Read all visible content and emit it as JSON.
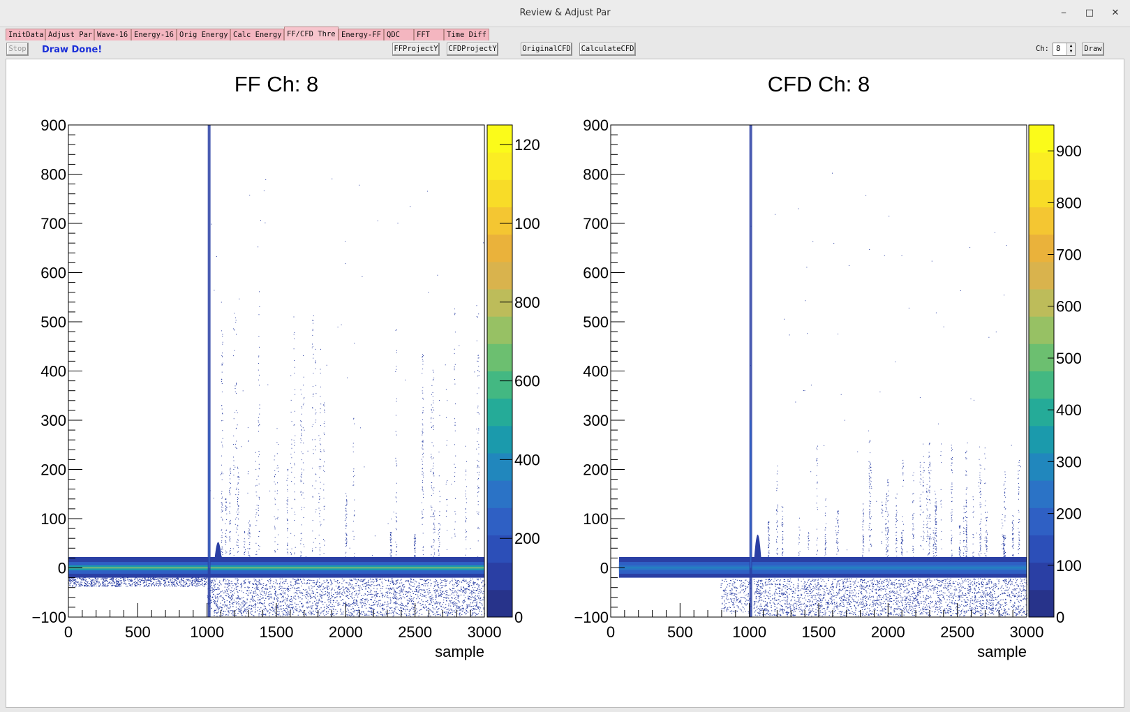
{
  "window": {
    "title": "Review & Adjust Par",
    "min_icon": "minimize-icon",
    "max_icon": "maximize-icon",
    "close_icon": "close-icon"
  },
  "tabs": [
    "InitData",
    "Adjust Par",
    "Wave-16",
    "Energy-16",
    "Orig Energy",
    "Calc Energy",
    "FF/CFD Thre",
    "Energy-FF",
    "QDC",
    "FFT",
    "Time Diff"
  ],
  "active_tab": "FF/CFD Thre",
  "toolbar": {
    "stop_label": "Stop",
    "status": "Draw Done!",
    "ffproject_label": "FFProjectY",
    "cfdproject_label": "CFDProjectY",
    "originalcfd_label": "OriginalCFD",
    "calculatecfd_label": "CalculateCFD",
    "ch_label": "Ch:",
    "ch_value": "8",
    "draw_label": "Draw"
  },
  "chart_data": [
    {
      "type": "heatmap",
      "title": "FF  Ch: 8",
      "xlabel": "sample",
      "ylabel": "",
      "xlim": [
        0,
        3000
      ],
      "ylim": [
        -100,
        900
      ],
      "x_ticks": [
        0,
        500,
        1000,
        1500,
        2000,
        2500,
        3000
      ],
      "y_ticks": [
        -100,
        0,
        100,
        200,
        300,
        400,
        500,
        600,
        700,
        800,
        900
      ],
      "colorbar": {
        "ticks": [
          "0",
          "200",
          "400",
          "600",
          "800",
          "100",
          "120"
        ],
        "tick_values": [
          0,
          200,
          400,
          600,
          800,
          1000,
          1200
        ],
        "max": 1250
      },
      "features": {
        "baseline": 0,
        "band": [
          -20,
          22
        ],
        "spike_x": 1015,
        "spike_top": 900,
        "bump_x": 1080,
        "bump_top": 65
      }
    },
    {
      "type": "heatmap",
      "title": "CFD  Ch: 8",
      "xlabel": "sample",
      "ylabel": "",
      "xlim": [
        0,
        3000
      ],
      "ylim": [
        -100,
        900
      ],
      "x_ticks": [
        0,
        500,
        1000,
        1500,
        2000,
        2500,
        3000
      ],
      "y_ticks": [
        -100,
        0,
        100,
        200,
        300,
        400,
        500,
        600,
        700,
        800,
        900
      ],
      "colorbar": {
        "ticks": [
          "0",
          "100",
          "200",
          "300",
          "400",
          "500",
          "600",
          "700",
          "800",
          "900"
        ],
        "tick_values": [
          0,
          100,
          200,
          300,
          400,
          500,
          600,
          700,
          800,
          900
        ],
        "max": 950
      },
      "features": {
        "baseline": 0,
        "band": [
          -20,
          22
        ],
        "spike_x": 1010,
        "spike_top": 900,
        "bump_x": 1060,
        "bump_top": 95
      }
    }
  ]
}
